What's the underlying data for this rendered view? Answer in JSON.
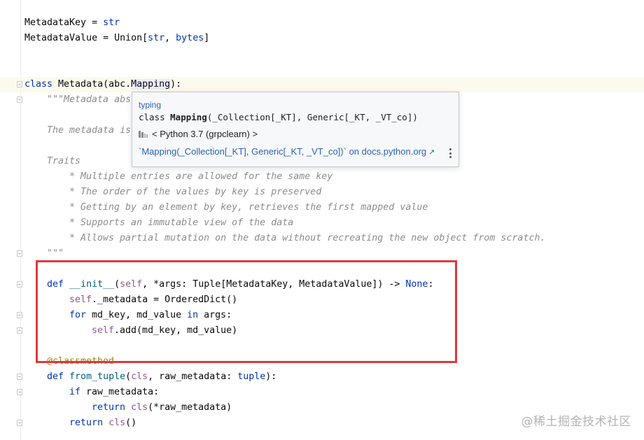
{
  "code": {
    "l1": {
      "a": "MetadataKey = ",
      "b": "str"
    },
    "l2": {
      "a": "MetadataValue = Union[",
      "b": "str",
      "c": ", ",
      "d": "bytes",
      "e": "]"
    },
    "l3": {
      "kw": "class",
      "a": " Metadata(abc.",
      "b": "Mapping",
      "c": "):"
    },
    "l4": "\"\"\"Metadata abs",
    "l5": "The metadata is",
    "l6": "Traits",
    "l7": "* Multiple entries are allowed for the same key",
    "l8": "* The order of the values by key is preserved",
    "l9": "* Getting by an element by key, retrieves the first mapped value",
    "l10": "* Supports an immutable view of the data",
    "l11": "* Allows partial mutation on the data without recreating the new object from scratch.",
    "l12": "\"\"\"",
    "l13": {
      "kw": "def",
      "a": " ",
      "fn": "__init__",
      "b": "(",
      "self": "self",
      "c": ", *args: Tuple[MetadataKey, MetadataValue]) -> ",
      "none": "None",
      "d": ":"
    },
    "l14": {
      "self": "self",
      "a": "._metadata = OrderedDict()"
    },
    "l15": {
      "kw1": "for",
      "a": " md_key, md_value ",
      "kw2": "in",
      "b": " args:"
    },
    "l16": {
      "self": "self",
      "a": ".add(md_key, md_value)"
    },
    "l17": "@classmethod",
    "l18": {
      "kw": "def",
      "a": " ",
      "fn": "from_tuple",
      "b": "(",
      "cls": "cls",
      "c": ", raw_metadata: ",
      "tuple": "tuple",
      "d": "):"
    },
    "l19": {
      "kw": "if",
      "a": " raw_metadata:"
    },
    "l20": {
      "kw": "return",
      "a": " ",
      "cls": "cls",
      "b": "(*raw_metadata)"
    },
    "l21": {
      "kw": "return",
      "a": " ",
      "cls": "cls",
      "b": "()"
    }
  },
  "popup": {
    "module": "typing",
    "sig_prefix": "class ",
    "sig_name": "Mapping",
    "sig_rest": "(_Collection[_KT], Generic[_KT, _VT_co])",
    "sdk": "< Python 3.7 (grpclearn) >",
    "link": "`Mapping(_Collection[_KT], Generic[_KT, _VT_co])` on docs.python.org",
    "external_icon": "↗"
  },
  "watermark": "@稀土掘金技术社区",
  "colors": {
    "keyword": "#0033b3",
    "self": "#94558d",
    "docstring": "#8c8c8c",
    "decorator": "#9e880d",
    "highlight_box": "#e0383c",
    "link": "#2b62b8"
  }
}
